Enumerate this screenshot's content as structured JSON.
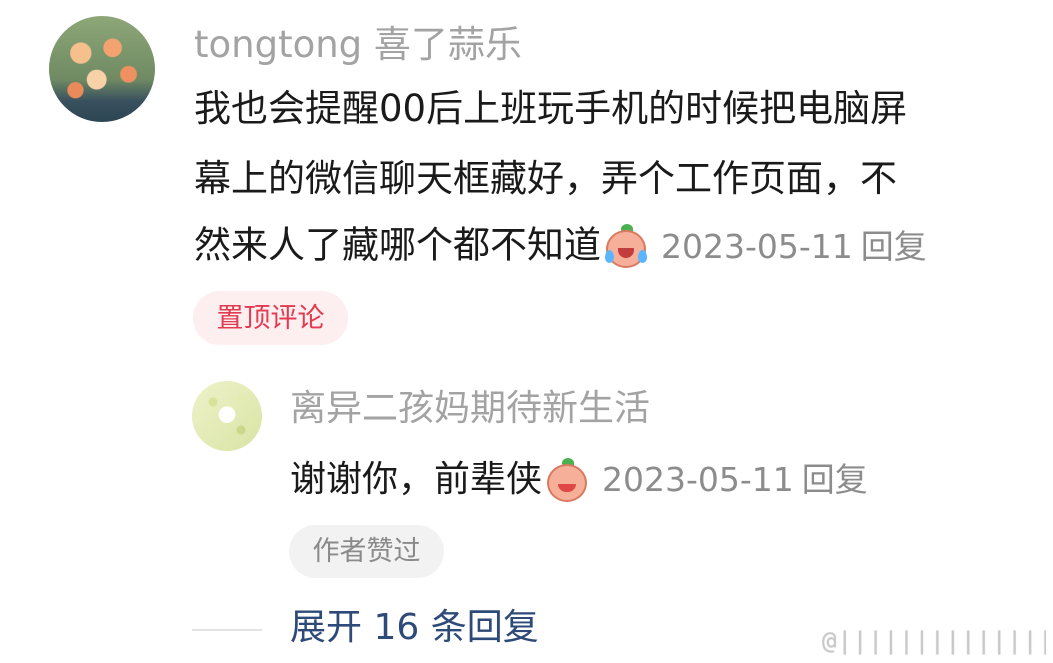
{
  "comment": {
    "username": "tongtong 喜了蒜乐",
    "lines": [
      "我也会提醒00后上班玩手机的时候把电脑屏",
      "幕上的微信聊天框藏好，弄个工作页面，不",
      "然来人了藏哪个都不知道"
    ],
    "emoji": "laughing-crying-peach-emoji",
    "date": "2023-05-11",
    "reply_label": "回复",
    "pinned_badge": "置顶评论"
  },
  "reply": {
    "username": "离异二孩妈期待新生活",
    "text": "谢谢你，前辈侠",
    "emoji": "salute-peach-emoji",
    "date": "2023-05-11",
    "reply_label": "回复",
    "author_liked_badge": "作者赞过"
  },
  "expand_replies": "展开 16 条回复",
  "watermark": "@||||||||||||||||||",
  "colors": {
    "username": "#a3a3a3",
    "pinned": "#e23a4f",
    "expand_link": "#2e4a78"
  }
}
